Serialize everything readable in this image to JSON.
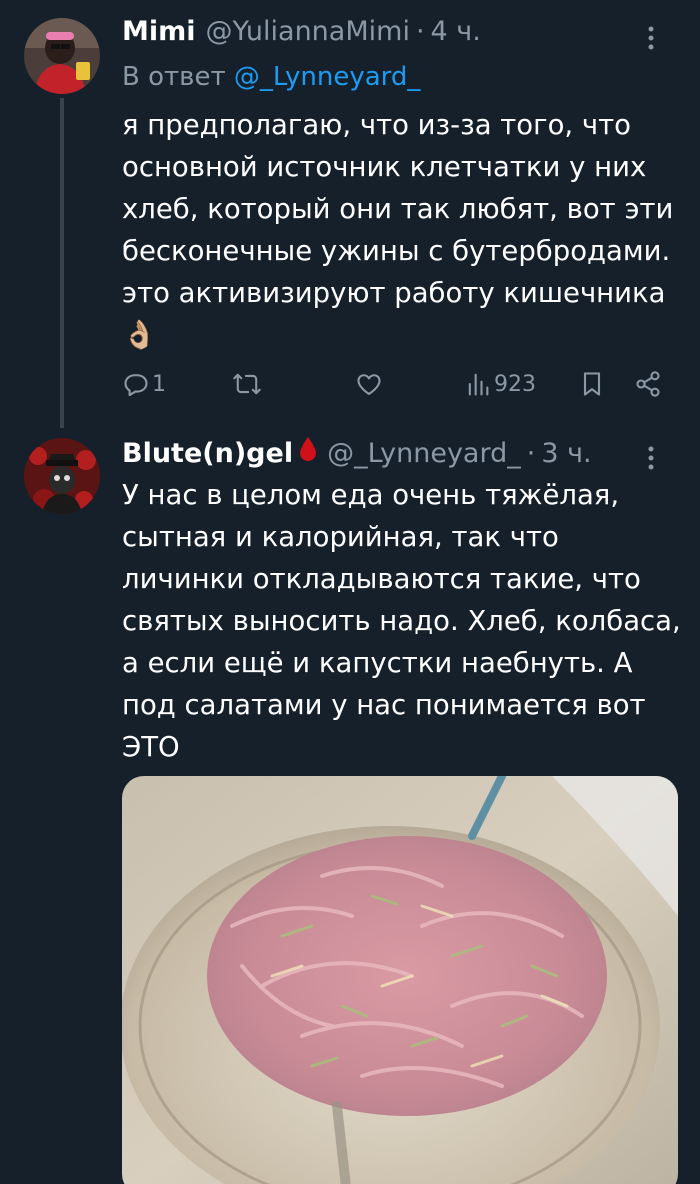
{
  "tweets": [
    {
      "display_name": "Mimi",
      "handle": "@YuliannaMimi",
      "separator": "·",
      "time": "4 ч.",
      "reply_prefix": "В ответ",
      "reply_mention": "@_Lynneyard_",
      "text": "я предполагаю, что из-за того, что основной источник клетчатки у них хлеб, который они так любят, вот эти бесконечные ужины с бутербродами. это активизируют работу кишечника",
      "emoji": "👌🏼",
      "replies_count": "1",
      "views_count": "923"
    },
    {
      "display_name": "Blute(n)gel",
      "handle": "@_Lynneyard_",
      "separator": "·",
      "time": "3 ч.",
      "text": "У нас в целом еда очень тяжёлая, сытная и калорийная, так что личинки откладываются такие, что святых выносить надо. Хлеб, колбаса, а если ещё и капустки наебнуть. А под салатами у нас понимается вот ЭТО"
    }
  ],
  "colors": {
    "background": "#15202b",
    "muted": "#8b98a5",
    "link": "#1d9bf0",
    "thread_line": "#38444d"
  }
}
